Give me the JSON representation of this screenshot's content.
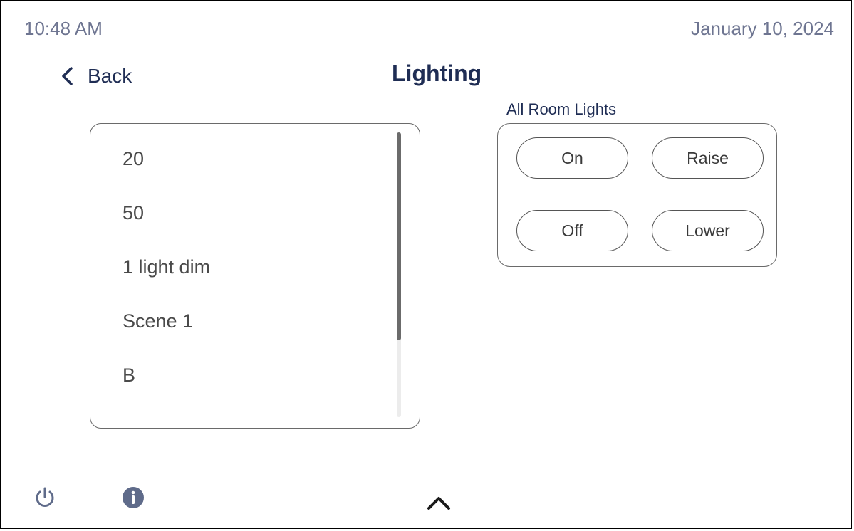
{
  "status": {
    "time": "10:48 AM",
    "date": "January 10, 2024"
  },
  "header": {
    "back_label": "Back",
    "title": "Lighting"
  },
  "scenes": {
    "items": [
      "20",
      "50",
      "1 light dim",
      "Scene 1",
      "B"
    ],
    "scroll_visible_fraction": 0.73
  },
  "room_lights": {
    "label": "All Room Lights",
    "buttons": {
      "on": "On",
      "raise": "Raise",
      "off": "Off",
      "lower": "Lower"
    }
  },
  "footer": {
    "icons": [
      "power-icon",
      "info-icon",
      "chevron-up-icon"
    ]
  },
  "colors": {
    "accent_text": "#1f2d54",
    "status_text": "#6e7591",
    "icon_blue": "#5f6b8a"
  }
}
